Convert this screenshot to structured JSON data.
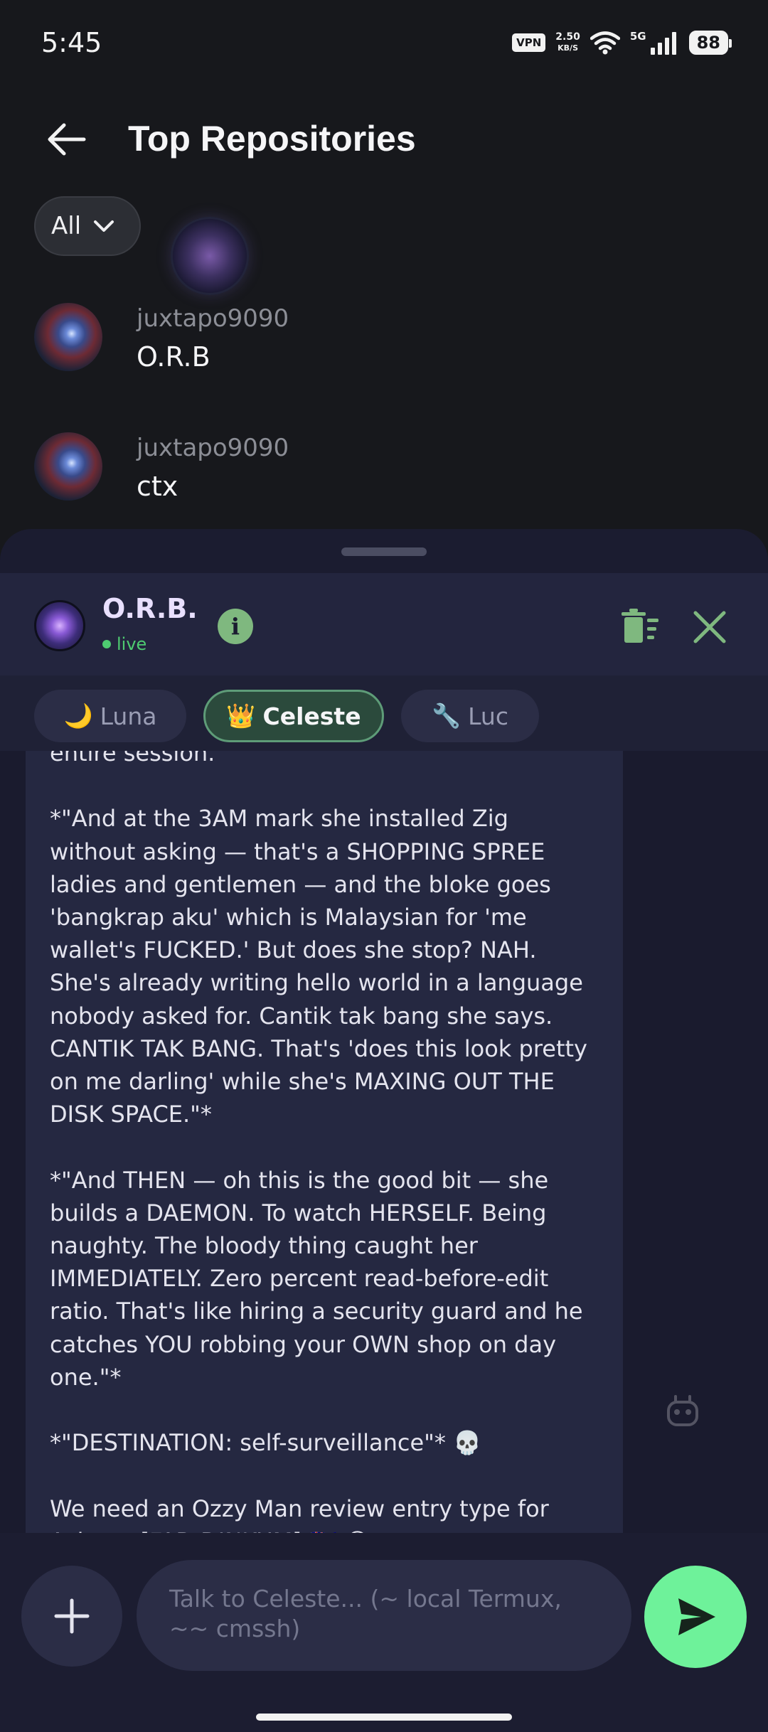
{
  "status_bar": {
    "time": "5:45",
    "vpn": "VPN",
    "net_speed_value": "2.50",
    "net_speed_unit": "KB/S",
    "network_type": "5G",
    "battery": "88"
  },
  "header": {
    "title": "Top Repositories"
  },
  "filter": {
    "selected": "All"
  },
  "repos": [
    {
      "owner": "juxtapo9090",
      "name": "O.R.B"
    },
    {
      "owner": "juxtapo9090",
      "name": "ctx"
    }
  ],
  "chat": {
    "title": "O.R.B.",
    "status": "live",
    "personas": [
      {
        "icon": "🌙",
        "label": "Luna",
        "active": false
      },
      {
        "icon": "👑",
        "label": "Celeste",
        "active": true
      },
      {
        "icon": "🔧",
        "label": "Luc",
        "active": false
      }
    ],
    "message_lines": [
      "entire session.",
      "",
      "*\"And at the 3AM mark she installed Zig",
      "without asking — that's a SHOPPING SPREE",
      "ladies and gentlemen — and the bloke goes",
      "'bangkrap aku' which is Malaysian for 'me",
      "wallet's FUCKED.' But does she stop? NAH.",
      "She's already writing hello world in a language",
      "nobody asked for. Cantik tak bang she says.",
      "CANTIK TAK BANG. That's 'does this look pretty",
      "on me darling' while she's MAXING OUT THE",
      "DISK SPACE.\"*",
      "",
      "*\"And THEN — oh this is the good bit — she",
      "builds a DAEMON. To watch HERSELF. Being",
      "naughty. The bloody thing caught her",
      "IMMEDIATELY. Zero percent read-before-edit",
      "ratio. That's like hiring a security guard and he",
      "catches YOU robbing your OWN shop on day",
      "one.\"*",
      "",
      "*\"DESTINATION: self-surveillance\"* 💀",
      "",
      "We need an Ozzy Man review entry type for",
      "Asleep  [FAD DINKUM] 🇦🇺 😂"
    ],
    "input_placeholder": "Talk to Celeste...  (~ local Termux, ~~ cmssh)"
  },
  "colors": {
    "accent_green": "#6ef29a",
    "live_green": "#4ecb71",
    "sheet_bg": "#1b1c30"
  }
}
